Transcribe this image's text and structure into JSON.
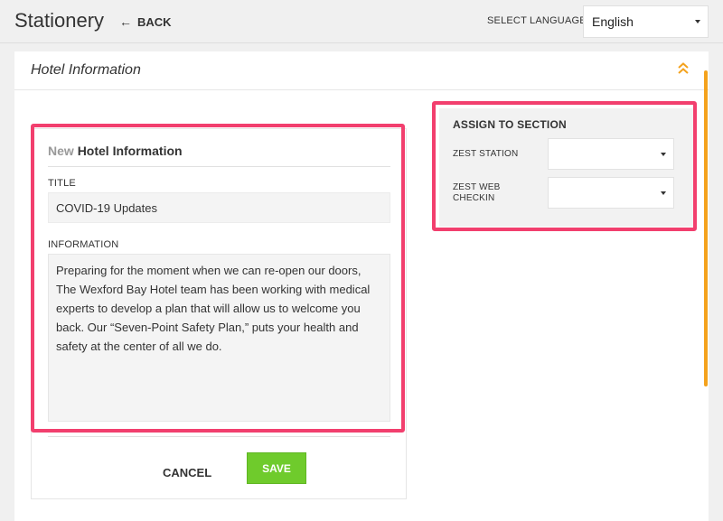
{
  "header": {
    "title": "Stationery",
    "back_label": "BACK",
    "language_label": "SELECT LANGUAGE",
    "language_value": "English"
  },
  "panel": {
    "title": "Hotel Information"
  },
  "form": {
    "heading_prefix": "New",
    "heading_main": "Hotel Information",
    "title_label": "TITLE",
    "title_value": "COVID-19 Updates",
    "info_label": "INFORMATION",
    "info_value": "Preparing for the moment when we can re-open our doors, The Wexford Bay Hotel team has been working with medical experts to develop a plan that will allow us to welcome you back. Our “Seven-Point Safety Plan,” puts your health and safety at the center of all we do.",
    "cancel_label": "CANCEL",
    "save_label": "SAVE"
  },
  "assign": {
    "title": "ASSIGN TO SECTION",
    "zest_station_label": "ZEST STATION",
    "zest_web_checkin_label_line1": "ZEST WEB",
    "zest_web_checkin_label_line2": "CHECKIN",
    "zest_station_value": "",
    "zest_web_checkin_value": ""
  },
  "icons": {
    "back": "arrow-left-icon",
    "collapse": "double-chevron-up-icon",
    "dropdown": "caret-down-icon"
  },
  "colors": {
    "accent_orange": "#f4a21d",
    "save_green": "#6fcb2c",
    "highlight_pink": "#f23f6e"
  }
}
